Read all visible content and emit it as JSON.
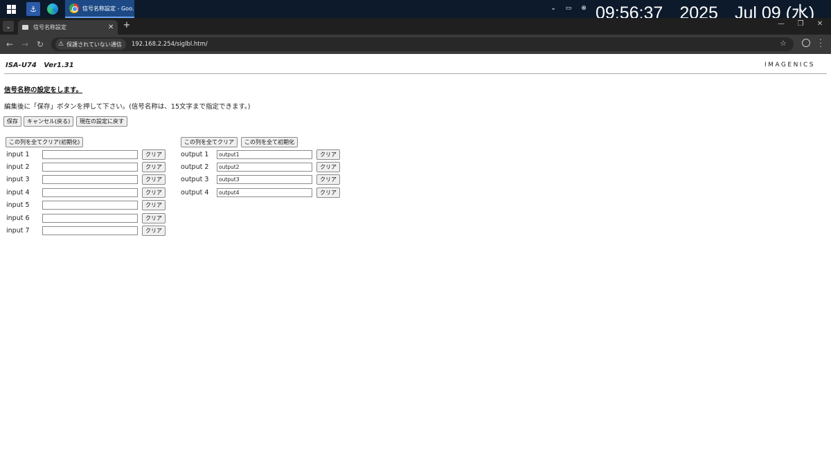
{
  "taskbar": {
    "chrome_task_label": "信号名称設定 - Goo...",
    "clock_time": "09:56:37",
    "clock_year": "2025",
    "clock_date": "Jul 09 (水)"
  },
  "browser": {
    "tab_title": "信号名称設定",
    "security_label": "保護されていない通信",
    "url": "192.168.2.254/siglbl.htm/"
  },
  "page": {
    "model": "ISA-U74   Ver1.31",
    "brand": "IMAGENICS",
    "heading": "信号名称の設定をします。",
    "instructions": "編集後に「保存」ボタンを押して下さい。(信号名称は、15文字まで指定できます。)",
    "buttons": {
      "save": "保存",
      "cancel": "キャンセル(戻る)",
      "revert": "現在の設定に戻す"
    },
    "inputs_column": {
      "clear_all": "この列を全てクリア(初期化)",
      "rows": [
        {
          "label": "input 1",
          "value": "",
          "clear": "クリア"
        },
        {
          "label": "input 2",
          "value": "",
          "clear": "クリア"
        },
        {
          "label": "input 3",
          "value": "",
          "clear": "クリア"
        },
        {
          "label": "input 4",
          "value": "",
          "clear": "クリア"
        },
        {
          "label": "input 5",
          "value": "",
          "clear": "クリア"
        },
        {
          "label": "input 6",
          "value": "",
          "clear": "クリア"
        },
        {
          "label": "input 7",
          "value": "",
          "clear": "クリア"
        }
      ]
    },
    "outputs_column": {
      "clear_all": "この列を全てクリア",
      "reset_all": "この列を全て初期化",
      "rows": [
        {
          "label": "output 1",
          "value": "output1",
          "clear": "クリア"
        },
        {
          "label": "output 2",
          "value": "output2",
          "clear": "クリア"
        },
        {
          "label": "output 3",
          "value": "output3",
          "clear": "クリア"
        },
        {
          "label": "output 4",
          "value": "output4",
          "clear": "クリア"
        }
      ]
    }
  }
}
